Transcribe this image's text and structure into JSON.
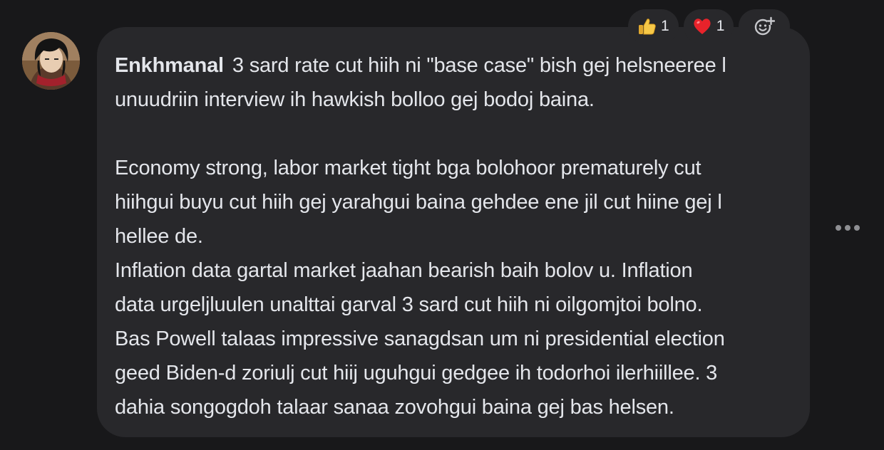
{
  "comment": {
    "author": "Enkhmanal",
    "lines": [
      "3 sard rate cut hiih ni \"base case\" bish gej helsneeree l",
      "unuudriin interview ih hawkish bolloo gej bodoj baina.",
      "",
      "Economy strong, labor market tight bga bolohoor prematurely cut",
      "hiihgui buyu cut hiih gej yarahgui baina gehdee ene jil cut hiine gej l",
      "hellee de.",
      "Inflation data gartal market jaahan bearish baih bolov u. Inflation",
      "data urgeljluulen unalttai garval 3 sard cut hiih ni oilgomjtoi bolno.",
      "Bas Powell talaas impressive sanagdsan um ni presidential election",
      "geed Biden-d zoriulj cut hiij uguhgui gedgee ih todorhoi ilerhiillee. 3",
      "dahia songogdoh talaar sanaa zovohgui baina gej bas helsen."
    ]
  },
  "reactions": [
    {
      "icon": "thumbs-up-icon",
      "count": "1"
    },
    {
      "icon": "heart-icon",
      "count": "1"
    }
  ],
  "colors": {
    "background": "#18181a",
    "bubble": "#28282b",
    "text": "#e4e6eb",
    "muted": "#8e8f93"
  }
}
